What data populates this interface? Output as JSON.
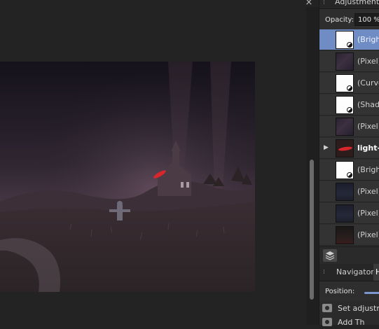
{
  "window": {
    "close_glyph": "×"
  },
  "adjustment_panel": {
    "tab_label": "Adjustment",
    "opacity_label": "Opacity:",
    "opacity_value": "100 %"
  },
  "layers": [
    {
      "name": "(Brigh",
      "thumb": "white",
      "adjustment_icon": true,
      "selected": true,
      "bold": false,
      "expander": ""
    },
    {
      "name": "(Pixel)",
      "thumb": "pixel",
      "adjustment_icon": false,
      "selected": false,
      "bold": false,
      "expander": ""
    },
    {
      "name": "(Curve",
      "thumb": "white",
      "adjustment_icon": true,
      "selected": false,
      "bold": false,
      "expander": ""
    },
    {
      "name": "(Shado",
      "thumb": "white",
      "adjustment_icon": true,
      "selected": false,
      "bold": false,
      "expander": ""
    },
    {
      "name": "(Pixel)",
      "thumb": "pixel",
      "adjustment_icon": false,
      "selected": false,
      "bold": false,
      "expander": ""
    },
    {
      "name": "light-",
      "thumb": "light",
      "adjustment_icon": false,
      "selected": false,
      "bold": true,
      "expander": "▶"
    },
    {
      "name": "(Brigh",
      "thumb": "white",
      "adjustment_icon": true,
      "selected": false,
      "bold": false,
      "expander": ""
    },
    {
      "name": "(Pixel)",
      "thumb": "pixel-dark",
      "adjustment_icon": false,
      "selected": false,
      "bold": false,
      "expander": ""
    },
    {
      "name": "(Pixel)",
      "thumb": "pixel-dark",
      "adjustment_icon": false,
      "selected": false,
      "bold": false,
      "expander": ""
    },
    {
      "name": "(Pixel)",
      "thumb": "pixel-red",
      "adjustment_icon": false,
      "selected": false,
      "bold": false,
      "expander": ""
    }
  ],
  "layers_footer": {
    "icon": "layers-stack-icon"
  },
  "navigator_panel": {
    "tab_navigator": "Navigator",
    "tab_history": "H",
    "position_label": "Position:",
    "position_value": 1.0
  },
  "history": [
    {
      "label": "Set adjustm",
      "icon": "camera-snapshot-icon"
    },
    {
      "label": "Add Th",
      "icon": "camera-snapshot-icon"
    }
  ],
  "colors": {
    "selection": "#6f8dc4",
    "slider": "#7a96cf",
    "light_streak": "#d8262a"
  }
}
